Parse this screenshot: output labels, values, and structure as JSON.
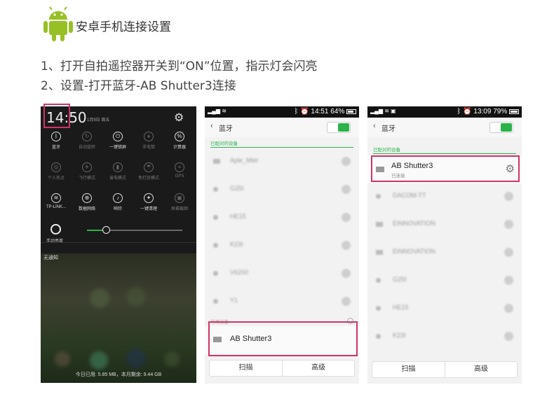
{
  "header": {
    "title": "安卓手机连接设置",
    "logo_icon": "android-robot-icon",
    "brand_color": "#97C024"
  },
  "steps": [
    "1、打开自拍遥控器开关到“ON”位置，指示灯会闪亮",
    "2、设置-打开蓝牙-AB Shutter3连接"
  ],
  "panel1": {
    "time": "14:50",
    "date": "1月9日 周五",
    "quick_settings_row1": [
      "蓝牙",
      "自动旋转",
      "一键锁屏",
      "手电筒",
      "计算器"
    ],
    "quick_settings_row2": [
      "个人热点",
      "飞行模式",
      "省电模式",
      "免打扰模式",
      "GPS"
    ],
    "quick_settings_row3": [
      "TP-LINK...",
      "数据网络",
      "响铃",
      "一键清理",
      "屏幕截图"
    ],
    "brightness_label": "手动亮度",
    "no_notifications": "无通知",
    "footer": "今日已用: 5.85 MB，本月剩余: 9.44 GB",
    "highlight_color": "#D0336A"
  },
  "panel2": {
    "status_time": "14:51",
    "status_battery": "64%",
    "title": "蓝牙",
    "paired_label": "已配对的设备",
    "paired_devices": [
      "Aple_Mier",
      "G25I",
      "HE15",
      "K23I",
      "V6200",
      "Y1"
    ],
    "available_label": "可用设备",
    "highlighted_device": "AB Shutter3",
    "scan_button": "扫描",
    "advanced_button": "高级"
  },
  "panel3": {
    "status_time": "13:09",
    "status_battery": "79%",
    "title": "蓝牙",
    "paired_label": "已配对的设备",
    "highlighted_device": "AB Shutter3",
    "highlighted_status": "已连接",
    "other_devices": [
      "DACOM-TT",
      "EINNOVATION",
      "EINNOVATION",
      "G25I",
      "HE15",
      "K23I"
    ],
    "scan_button": "扫描",
    "advanced_button": "高级"
  }
}
